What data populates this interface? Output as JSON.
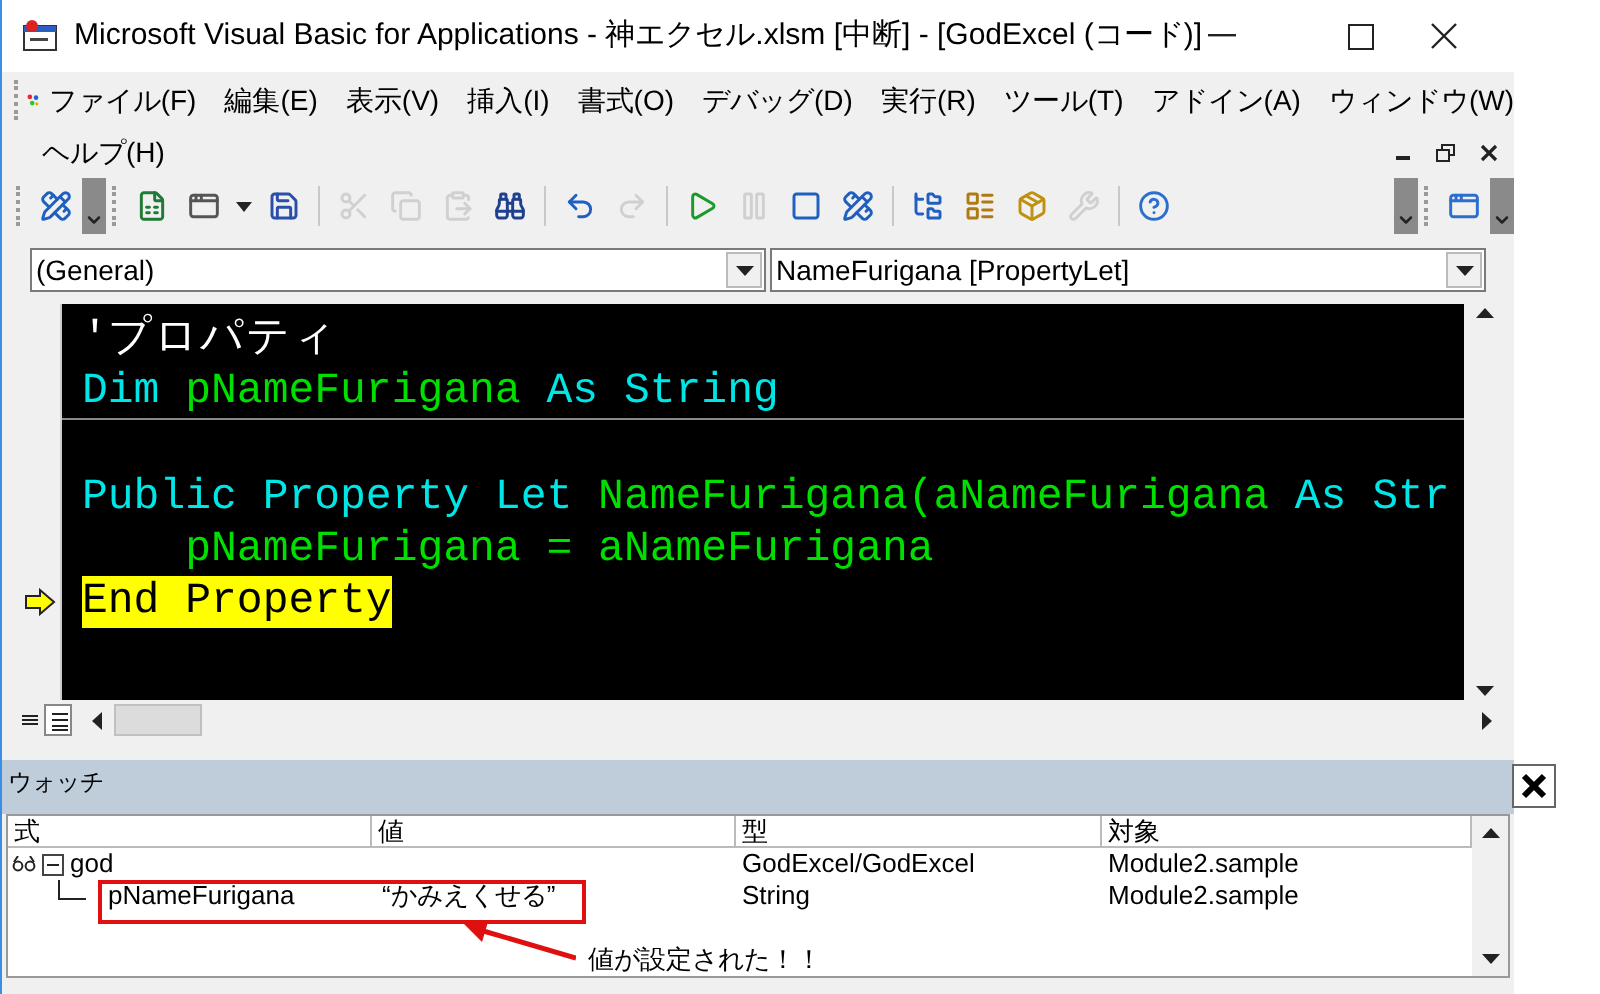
{
  "window": {
    "title": "Microsoft Visual Basic for Applications - 神エクセル.xlsm [中断] - [GodExcel (コード)]"
  },
  "menu": {
    "items": [
      {
        "label": "ファイル(F)"
      },
      {
        "label": "編集(E)"
      },
      {
        "label": "表示(V)"
      },
      {
        "label": "挿入(I)"
      },
      {
        "label": "書式(O)"
      },
      {
        "label": "デバッグ(D)"
      },
      {
        "label": "実行(R)"
      },
      {
        "label": "ツール(T)"
      },
      {
        "label": "アドイン(A)"
      },
      {
        "label": "ウィンドウ(W)"
      },
      {
        "label": "ヘルプ(H)"
      }
    ]
  },
  "toolbar": {
    "items": [
      {
        "kind": "grip"
      },
      {
        "kind": "design",
        "disabled": false
      },
      {
        "kind": "overflow"
      },
      {
        "kind": "grip"
      },
      {
        "kind": "excel",
        "disabled": false
      },
      {
        "kind": "userform",
        "disabled": false
      },
      {
        "kind": "dropdown",
        "disabled": false
      },
      {
        "kind": "save",
        "disabled": false
      },
      {
        "kind": "separator"
      },
      {
        "kind": "cut",
        "disabled": true
      },
      {
        "kind": "copy",
        "disabled": true
      },
      {
        "kind": "paste",
        "disabled": true
      },
      {
        "kind": "find",
        "disabled": false
      },
      {
        "kind": "separator"
      },
      {
        "kind": "undo",
        "disabled": false
      },
      {
        "kind": "redo",
        "disabled": true
      },
      {
        "kind": "separator"
      },
      {
        "kind": "run",
        "disabled": false
      },
      {
        "kind": "pause",
        "disabled": true
      },
      {
        "kind": "stop",
        "disabled": false
      },
      {
        "kind": "design",
        "disabled": false
      },
      {
        "kind": "separator"
      },
      {
        "kind": "project",
        "disabled": false
      },
      {
        "kind": "properties",
        "disabled": false
      },
      {
        "kind": "browser",
        "disabled": false
      },
      {
        "kind": "toolbox",
        "disabled": true
      },
      {
        "kind": "separator"
      },
      {
        "kind": "help",
        "disabled": false
      },
      {
        "kind": "spacer"
      },
      {
        "kind": "overflow"
      },
      {
        "kind": "grip"
      },
      {
        "kind": "window",
        "disabled": false
      },
      {
        "kind": "overflow"
      }
    ]
  },
  "object_dropdown": {
    "value": "(General)"
  },
  "procedure_dropdown": {
    "value": "NameFurigana [PropertyLet]"
  },
  "code": {
    "lines": [
      {
        "kind": "code",
        "current": false,
        "tokens": [
          {
            "kind": "comment",
            "text": "'プロパティ"
          }
        ]
      },
      {
        "kind": "code",
        "current": false,
        "tokens": [
          {
            "kind": "keyword",
            "text": "Dim "
          },
          {
            "kind": "ident",
            "text": "pNameFurigana "
          },
          {
            "kind": "keyword",
            "text": "As String"
          }
        ]
      },
      {
        "kind": "separator"
      },
      {
        "kind": "code",
        "current": false
      },
      {
        "kind": "code",
        "current": false,
        "tokens": [
          {
            "kind": "keyword",
            "text": "Public Property Let "
          },
          {
            "kind": "ident",
            "text": "NameFurigana(aNameFurigana "
          },
          {
            "kind": "keyword",
            "text": "As Str"
          }
        ]
      },
      {
        "kind": "code",
        "current": false,
        "tokens": [
          {
            "kind": "ident",
            "text": "    pNameFurigana = aNameFurigana"
          }
        ]
      },
      {
        "kind": "code",
        "current": true,
        "tokens": [
          {
            "kind": "keyword",
            "text": "End Property"
          }
        ]
      }
    ]
  },
  "watch": {
    "title": "ウォッチ",
    "columns": [
      "式",
      "値",
      "型",
      "対象"
    ],
    "rows": [
      {
        "expression": "god",
        "type": "GodExcel/GodExcel",
        "context": "Module2.sample",
        "expanded": true,
        "children": [
          {
            "expression": "pNameFurigana",
            "value": "“かみえくせる”",
            "type": "String",
            "context": "Module2.sample"
          }
        ]
      }
    ]
  },
  "annotation": {
    "text": "値が設定された！！"
  }
}
